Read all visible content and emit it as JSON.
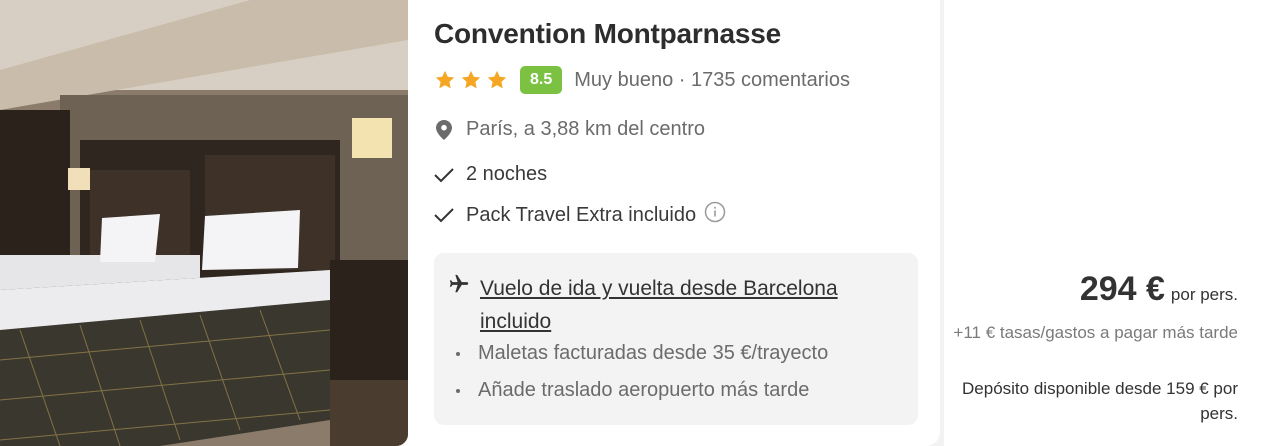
{
  "hotel": {
    "name": "Convention Montparnasse",
    "stars": 3,
    "score": "8.5",
    "rating_text": "Muy bueno · 1735 comentarios",
    "location": "París, a 3,88 km del centro",
    "features": [
      "2 noches",
      "Pack Travel Extra incluido"
    ]
  },
  "flight": {
    "title": "Vuelo de ida y vuelta desde Barcelona incluido",
    "extras": [
      "Maletas facturadas desde 35 €/trayecto",
      "Añade traslado aeropuerto más tarde"
    ]
  },
  "pricing": {
    "price": "294 €",
    "per": "por pers.",
    "fees": "+11 € tasas/gastos a pagar más tarde",
    "deposit": "Depósito disponible desde 159 € por pers."
  },
  "colors": {
    "score_bg": "#7cc242",
    "star": "#f5a623"
  },
  "icons": {
    "location": "map-pin-icon",
    "check": "check-icon",
    "info": "info-icon",
    "flight": "airplane-icon"
  }
}
